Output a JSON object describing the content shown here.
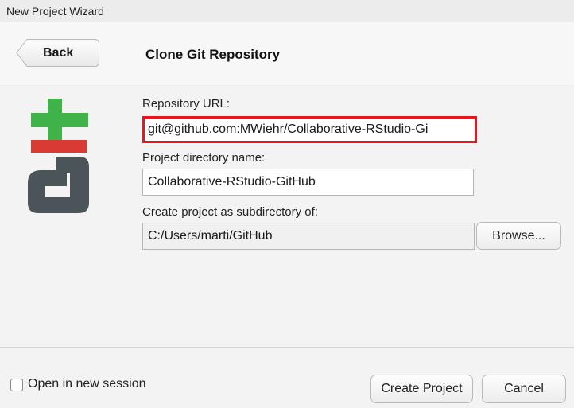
{
  "window": {
    "title": "New Project Wizard"
  },
  "header": {
    "back_label": "Back",
    "title": "Clone Git Repository"
  },
  "logo": {
    "icon": "git-logo-icon",
    "colors": {
      "plus": "#3fb24a",
      "bar": "#d93a33",
      "g": "#4a5459"
    }
  },
  "form": {
    "repo_url_label": "Repository URL:",
    "repo_url_value": "git@github.com:MWiehr/Collaborative-RStudio-Gi",
    "project_dir_label": "Project directory name:",
    "project_dir_value": "Collaborative-RStudio-GitHub",
    "subdir_label": "Create project as subdirectory of:",
    "subdir_value": "C:/Users/marti/GitHub",
    "browse_label": "Browse..."
  },
  "footer": {
    "open_new_session_label": "Open in new session",
    "create_label": "Create Project",
    "cancel_label": "Cancel"
  },
  "highlight_color": "#e8141f"
}
